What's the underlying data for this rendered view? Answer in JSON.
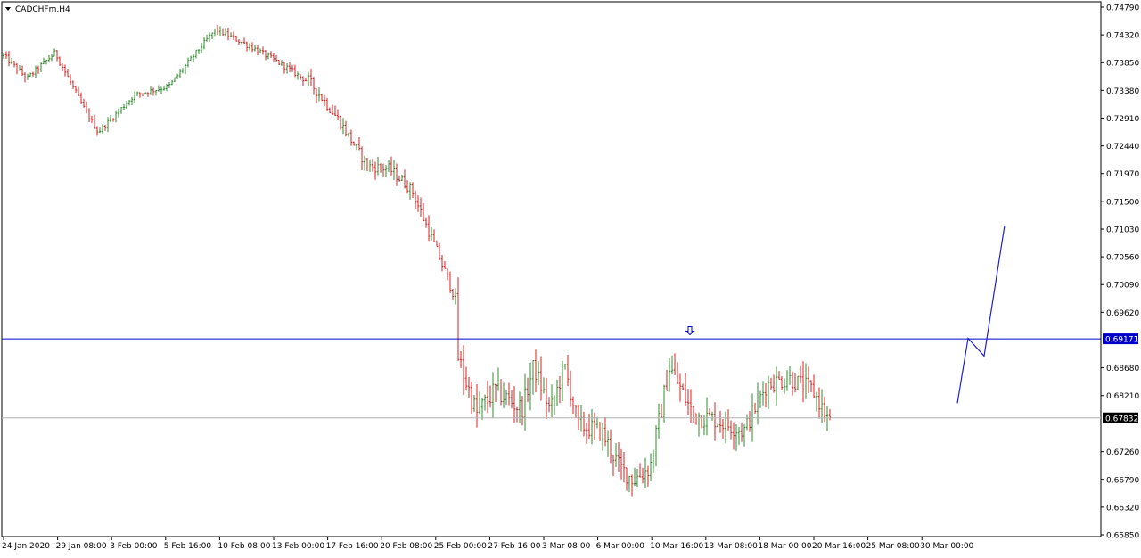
{
  "header": {
    "symbol_label": "CADCHFm,H4"
  },
  "colors": {
    "bull": "#2e8b2e",
    "bear": "#d42020",
    "hline": "#0000cc",
    "current_line": "#b0b0b0",
    "projection": "#1f1fd0",
    "frame": "#000000"
  },
  "chart_data": {
    "type": "candlestick",
    "symbol": "CADCHFm",
    "timeframe": "H4",
    "ylim": [
      0.6585,
      0.7479
    ],
    "y_ticks": [
      "0.74790",
      "0.74320",
      "0.73850",
      "0.73380",
      "0.72910",
      "0.72440",
      "0.71970",
      "0.71500",
      "0.71030",
      "0.70560",
      "0.70090",
      "0.69620",
      "0.69171",
      "0.68680",
      "0.68210",
      "0.67832",
      "0.67260",
      "0.66790",
      "0.66320",
      "0.65850"
    ],
    "x_ticks": [
      "24 Jan 2020",
      "29 Jan 08:00",
      "3 Feb 00:00",
      "5 Feb 16:00",
      "10 Feb 08:00",
      "13 Feb 00:00",
      "17 Feb 16:00",
      "20 Feb 08:00",
      "25 Feb 00:00",
      "27 Feb 16:00",
      "3 Mar 08:00",
      "6 Mar 00:00",
      "10 Mar 16:00",
      "13 Mar 08:00",
      "18 Mar 00:00",
      "20 Mar 16:00",
      "25 Mar 08:00",
      "30 Mar 00:00"
    ],
    "horizontal_line": {
      "price": 0.69171,
      "label": "0.69171"
    },
    "current_price": {
      "price": 0.67832,
      "label": "0.67832"
    },
    "arrow_marker": {
      "price": 0.6924,
      "icon": "down-arrow-icon"
    },
    "projection_path": [
      [
        0.6808,
        0.6918
      ],
      [
        0.6918,
        0.6888
      ],
      [
        0.6888,
        0.7109
      ]
    ],
    "segments": [
      {
        "bars": 36,
        "start": 0.7397,
        "end": 0.727,
        "pivots": [
          [
            0.25,
            0.7358
          ],
          [
            0.55,
            0.7402
          ],
          [
            0.85,
            0.731
          ]
        ],
        "vol": 0.0012
      },
      {
        "bars": 44,
        "start": 0.727,
        "end": 0.744,
        "pivots": [
          [
            0.3,
            0.733
          ],
          [
            0.6,
            0.7345
          ],
          [
            0.85,
            0.7405
          ]
        ],
        "vol": 0.0011
      },
      {
        "bars": 34,
        "start": 0.744,
        "end": 0.7355,
        "pivots": [
          [
            0.4,
            0.741
          ],
          [
            0.75,
            0.738
          ]
        ],
        "vol": 0.0012
      },
      {
        "bars": 56,
        "start": 0.7355,
        "end": 0.6985,
        "pivots": [
          [
            0.2,
            0.729
          ],
          [
            0.4,
            0.721
          ],
          [
            0.55,
            0.7205
          ],
          [
            0.7,
            0.717
          ],
          [
            0.85,
            0.708
          ]
        ],
        "vol": 0.0022
      },
      {
        "bars": 24,
        "start": 0.6885,
        "end": 0.68,
        "pivots": [
          [
            0.3,
            0.679
          ],
          [
            0.6,
            0.683
          ]
        ],
        "vol": 0.0045
      },
      {
        "bars": 22,
        "start": 0.68,
        "end": 0.677,
        "pivots": [
          [
            0.2,
            0.687
          ],
          [
            0.5,
            0.6795
          ],
          [
            0.75,
            0.687
          ]
        ],
        "vol": 0.004
      },
      {
        "bars": 20,
        "start": 0.677,
        "end": 0.668,
        "pivots": [
          [
            0.4,
            0.676
          ],
          [
            0.75,
            0.67
          ]
        ],
        "vol": 0.004
      },
      {
        "bars": 30,
        "start": 0.668,
        "end": 0.678,
        "pivots": [
          [
            0.2,
            0.67
          ],
          [
            0.45,
            0.687
          ],
          [
            0.75,
            0.679
          ]
        ],
        "vol": 0.0045
      },
      {
        "bars": 44,
        "start": 0.678,
        "end": 0.6775,
        "pivots": [
          [
            0.25,
            0.676
          ],
          [
            0.45,
            0.684
          ],
          [
            0.65,
            0.685
          ],
          [
            0.85,
            0.683
          ]
        ],
        "vol": 0.0038
      }
    ]
  }
}
